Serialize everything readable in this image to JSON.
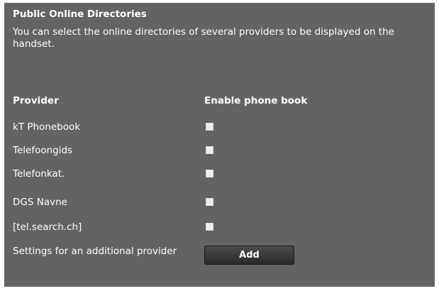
{
  "title": "Public Online Directories",
  "description": "You can select the online directories of several providers to be displayed on the handset.",
  "table": {
    "header_provider": "Provider",
    "header_enable": "Enable phone book",
    "providers": [
      {
        "name": "kT Phonebook",
        "enabled": false
      },
      {
        "name": "Telefoongids",
        "enabled": false
      },
      {
        "name": "Telefonkat.",
        "enabled": false
      },
      {
        "name": "DGS Navne",
        "enabled": false
      },
      {
        "name": "[tel.search.ch]",
        "enabled": false
      }
    ]
  },
  "additional": {
    "label": "Settings for an additional provider",
    "button_label": "Add"
  },
  "colors": {
    "panel_background": "#636363",
    "text": "#ffffff",
    "checkbox": "#ededed",
    "button_background": "#333333"
  }
}
